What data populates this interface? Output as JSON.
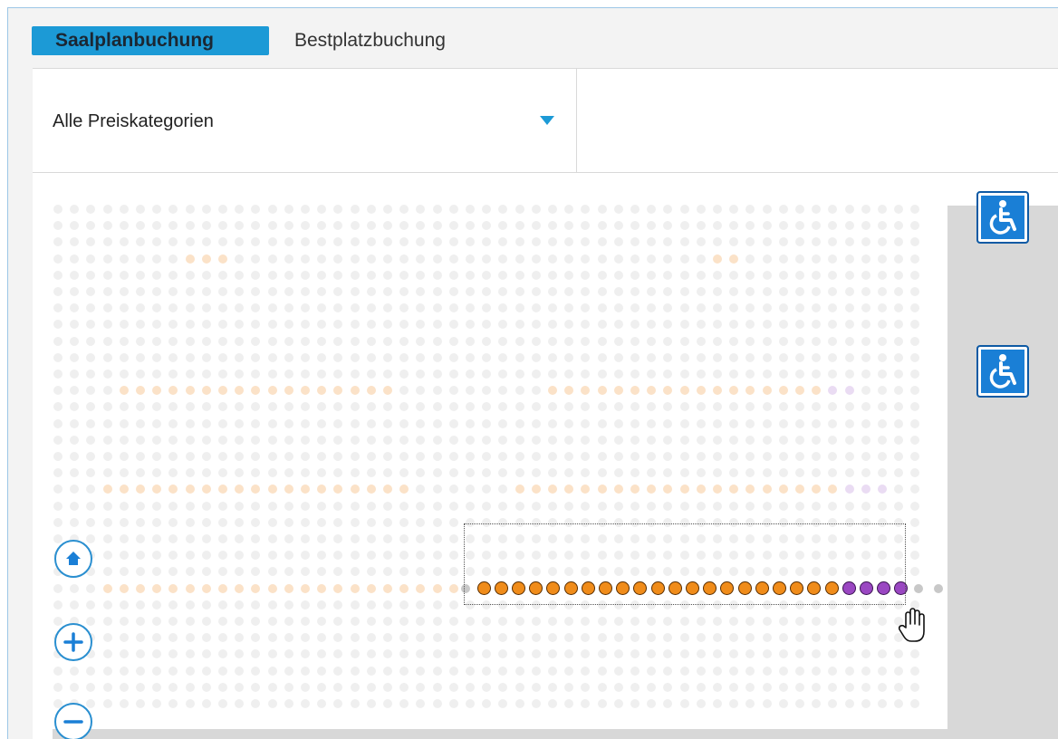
{
  "tabs": [
    {
      "label": "Saalplanbuchung",
      "active": true
    },
    {
      "label": "Bestplatzbuchung",
      "active": false
    }
  ],
  "filter": {
    "price_category": "Alle Preiskategorien",
    "dropdown_icon": "triangle-down-icon"
  },
  "controls": {
    "home_icon": "home-icon",
    "zoom_in_icon": "plus-icon",
    "zoom_out_icon": "minus-icon"
  },
  "legend_icons": [
    "wheelchair-icon",
    "wheelchair-icon"
  ],
  "colors": {
    "accent": "#1c9ad6",
    "seat_orange": "#f08c1a",
    "seat_purple": "#9a47c2",
    "seat_unavailable": "#c8c8c8",
    "wheelchair_blue": "#1a7fd6"
  },
  "selected_row": {
    "orange_seats": 21,
    "purple_seats": 4,
    "unavailable_seats_before": 1,
    "unavailable_seats_after": 2
  }
}
